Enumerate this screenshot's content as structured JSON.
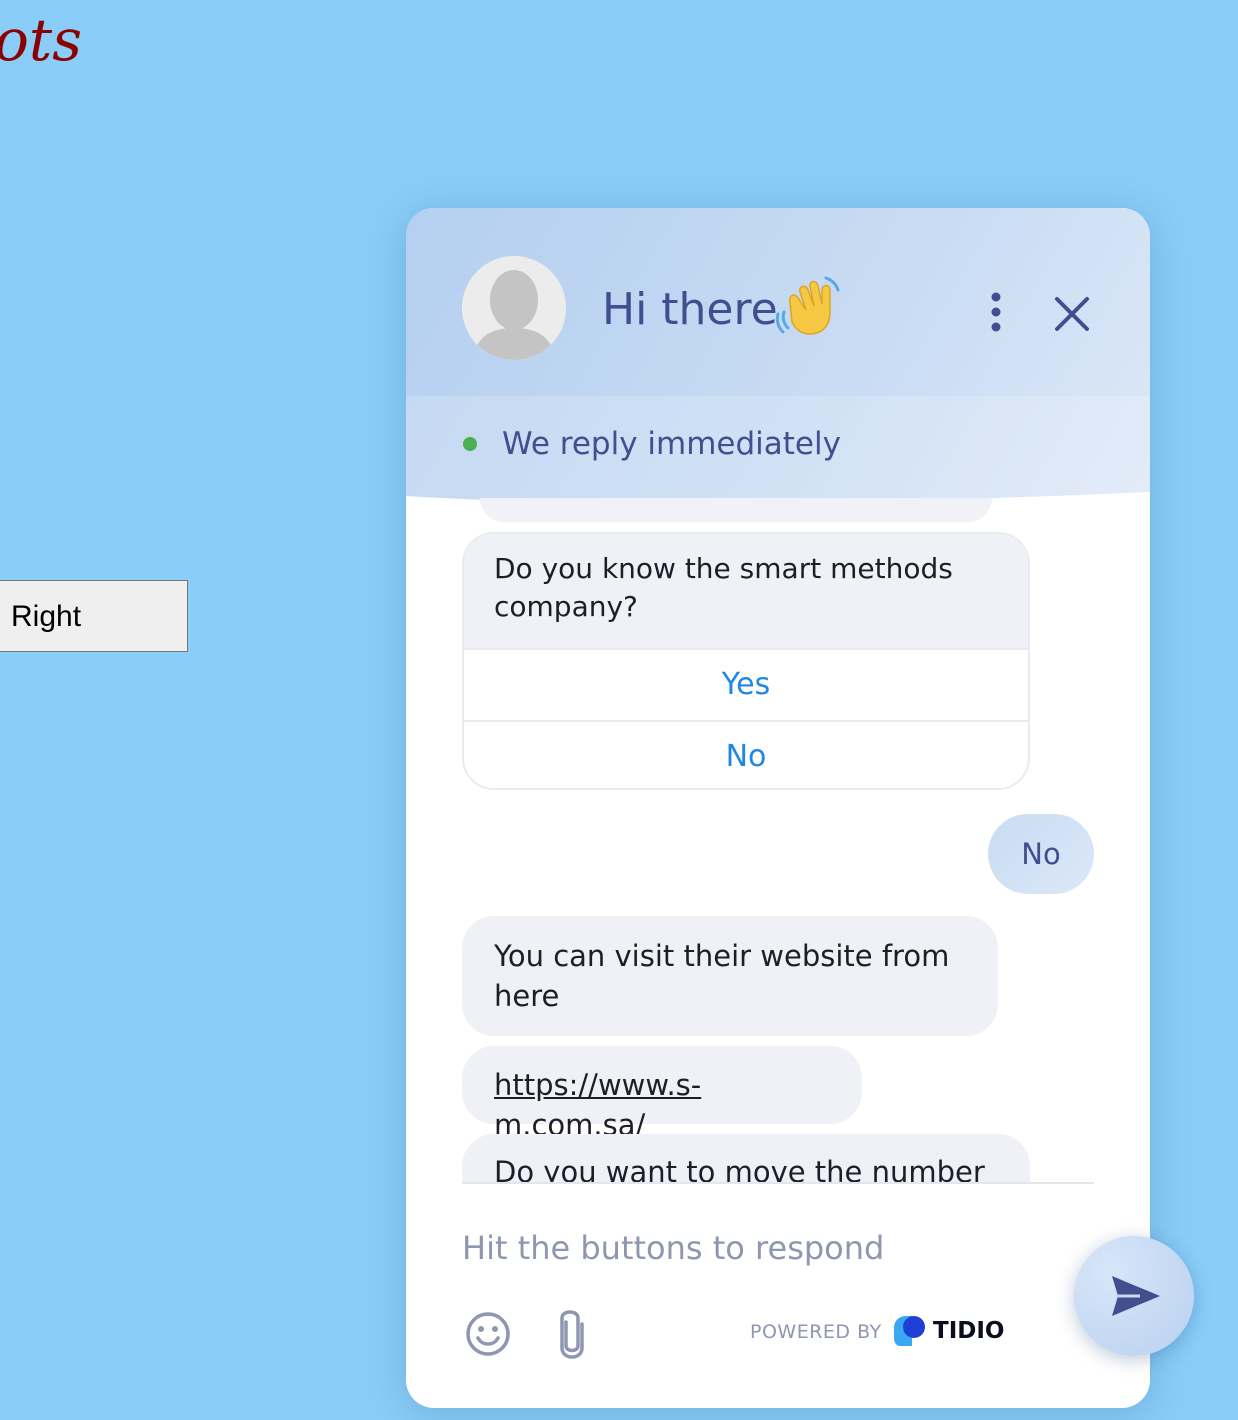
{
  "page": {
    "heading_fragment": "ots",
    "right_button_label": "Right"
  },
  "chat": {
    "header": {
      "title": "Hi there",
      "status": "We reply immediately",
      "status_color": "#4caf50"
    },
    "messages": [
      {
        "from": "bot",
        "text": "Do you know the smart methods company?",
        "options": [
          "Yes",
          "No"
        ]
      },
      {
        "from": "user",
        "text": "No"
      },
      {
        "from": "bot",
        "text": "You can visit their website from here"
      },
      {
        "from": "bot",
        "text": "https://www.s-m.com.sa/"
      },
      {
        "from": "bot",
        "text": "Do you want to move the number"
      }
    ],
    "input": {
      "placeholder": "Hit the buttons to respond"
    },
    "footer": {
      "powered_by": "POWERED BY",
      "brand": "TIDIO"
    },
    "colors": {
      "accent": "#414e8f",
      "option_link": "#1f88e5",
      "bot_bubble": "#f0f1f6"
    }
  }
}
